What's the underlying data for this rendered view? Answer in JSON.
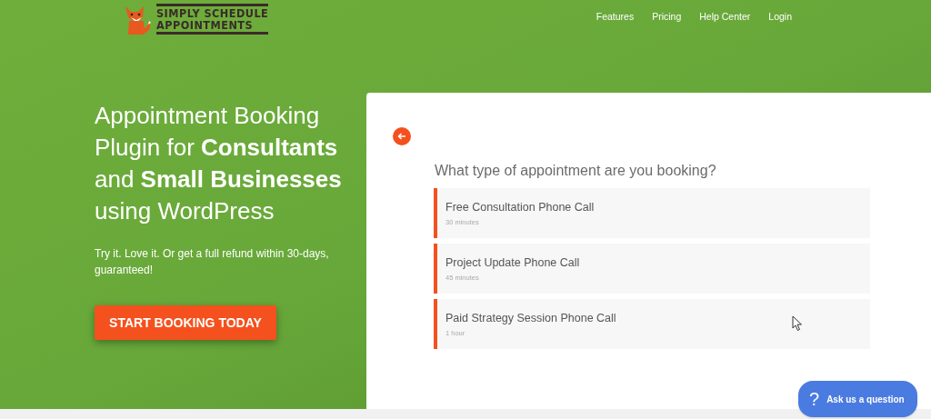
{
  "logo": {
    "lines": [
      "SIMPLY SCHEDULE",
      "APPOINTMENTS"
    ]
  },
  "nav": [
    {
      "label": "Features"
    },
    {
      "label": "Pricing"
    },
    {
      "label": "Help Center"
    },
    {
      "label": "Login"
    }
  ],
  "hero": {
    "headline": "Appointment Booking Plugin for **Consultants** and **Small Businesses** using WordPress",
    "tagline": "Try it. Love it. Or get a full refund within 30-days, guaranteed!",
    "cta": "START BOOKING TODAY"
  },
  "booking": {
    "question": "What type of appointment are you booking?",
    "options": [
      {
        "name": "Free Consultation Phone Call",
        "duration": "30 minutes"
      },
      {
        "name": "Project Update Phone Call",
        "duration": "45 minutes"
      },
      {
        "name": "Paid Strategy Session Phone Call",
        "duration": "1 hour"
      }
    ]
  },
  "help_button": {
    "icon": "?",
    "label": "Ask us a question"
  }
}
